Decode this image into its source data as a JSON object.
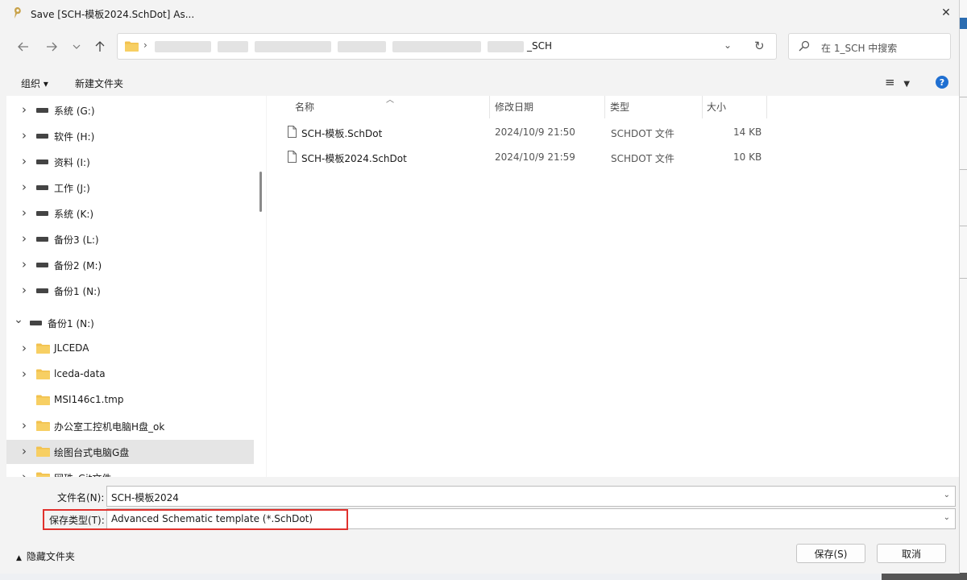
{
  "window": {
    "title": "Save [SCH-模板2024.SchDot] As..."
  },
  "navigation": {
    "back_icon": "arrow-left-icon",
    "forward_icon": "arrow-right-icon",
    "recent_icon": "chevron-down-icon",
    "up_icon": "arrow-up-icon"
  },
  "address": {
    "path_tail": "_SCH"
  },
  "search": {
    "placeholder": "在 1_SCH 中搜索"
  },
  "toolbar": {
    "organize_label": "组织 ▾",
    "new_folder_label": "新建文件夹"
  },
  "nav_pane": {
    "items": [
      {
        "label": "系统 (G:)",
        "kind": "drive",
        "level": 1,
        "expand": "collapsed"
      },
      {
        "label": "软件 (H:)",
        "kind": "drive",
        "level": 1,
        "expand": "collapsed"
      },
      {
        "label": "资料 (I:)",
        "kind": "drive",
        "level": 1,
        "expand": "collapsed"
      },
      {
        "label": "工作 (J:)",
        "kind": "drive",
        "level": 1,
        "expand": "collapsed"
      },
      {
        "label": "系统 (K:)",
        "kind": "drive",
        "level": 1,
        "expand": "collapsed"
      },
      {
        "label": "备份3 (L:)",
        "kind": "drive",
        "level": 1,
        "expand": "collapsed"
      },
      {
        "label": "备份2 (M:)",
        "kind": "drive",
        "level": 1,
        "expand": "collapsed"
      },
      {
        "label": "备份1 (N:)",
        "kind": "drive",
        "level": 1,
        "expand": "collapsed"
      },
      {
        "label": "备份1 (N:)",
        "kind": "drive",
        "level": 0,
        "expand": "expanded"
      },
      {
        "label": "JLCEDA",
        "kind": "folder",
        "level": 1,
        "expand": "collapsed"
      },
      {
        "label": "lceda-data",
        "kind": "folder",
        "level": 1,
        "expand": "collapsed"
      },
      {
        "label": "MSI146c1.tmp",
        "kind": "folder",
        "level": 1,
        "expand": "none"
      },
      {
        "label": "办公室工控机电脑H盘_ok",
        "kind": "folder",
        "level": 1,
        "expand": "collapsed"
      },
      {
        "label": "绘图台式电脑G盘",
        "kind": "folder",
        "level": 1,
        "expand": "collapsed",
        "selected": true
      },
      {
        "label": "网珠_Git文件",
        "kind": "folder",
        "level": 1,
        "expand": "collapsed"
      }
    ]
  },
  "file_list": {
    "columns": {
      "name": "名称",
      "modified": "修改日期",
      "type": "类型",
      "size": "大小"
    },
    "rows": [
      {
        "name": "SCH-模板.SchDot",
        "modified": "2024/10/9 21:50",
        "type": "SCHDOT 文件",
        "size": "14 KB"
      },
      {
        "name": "SCH-模板2024.SchDot",
        "modified": "2024/10/9 21:59",
        "type": "SCHDOT 文件",
        "size": "10 KB"
      }
    ]
  },
  "form": {
    "filename_label": "文件名(N):",
    "filename_value": "SCH-模板2024",
    "filetype_label": "保存类型(T):",
    "filetype_value": "Advanced Schematic template (*.SchDot)"
  },
  "footer": {
    "hide_folders_label": "隐藏文件夹",
    "save_label": "保存(S)",
    "cancel_label": "取消"
  },
  "colors": {
    "accent": "#1f6fd1",
    "highlight": "#e0312d",
    "folder": "#f2c14e",
    "selected_row": "#e5e5e5"
  }
}
